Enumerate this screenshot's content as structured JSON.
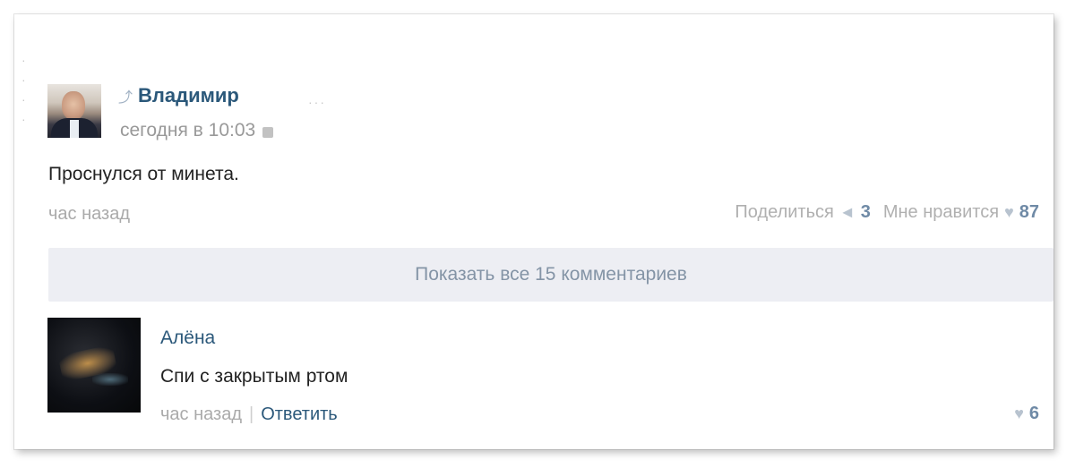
{
  "post": {
    "author": "Владимир",
    "time": "сегодня в 10:03",
    "text": "Проснулся от минета.",
    "footer_time": "час назад",
    "share_label": "Поделиться",
    "share_count": "3",
    "like_label": "Мне нравится",
    "like_count": "87"
  },
  "show_all_comments": "Показать все 15 комментариев",
  "comment": {
    "author": "Алёна",
    "text": "Спи с закрытым ртом",
    "time": "час назад",
    "separator": "|",
    "reply_label": "Ответить",
    "like_count": "6"
  },
  "icons": {
    "link": "link-icon",
    "lock": "lock-icon",
    "share": "share-icon",
    "heart": "heart-icon"
  }
}
